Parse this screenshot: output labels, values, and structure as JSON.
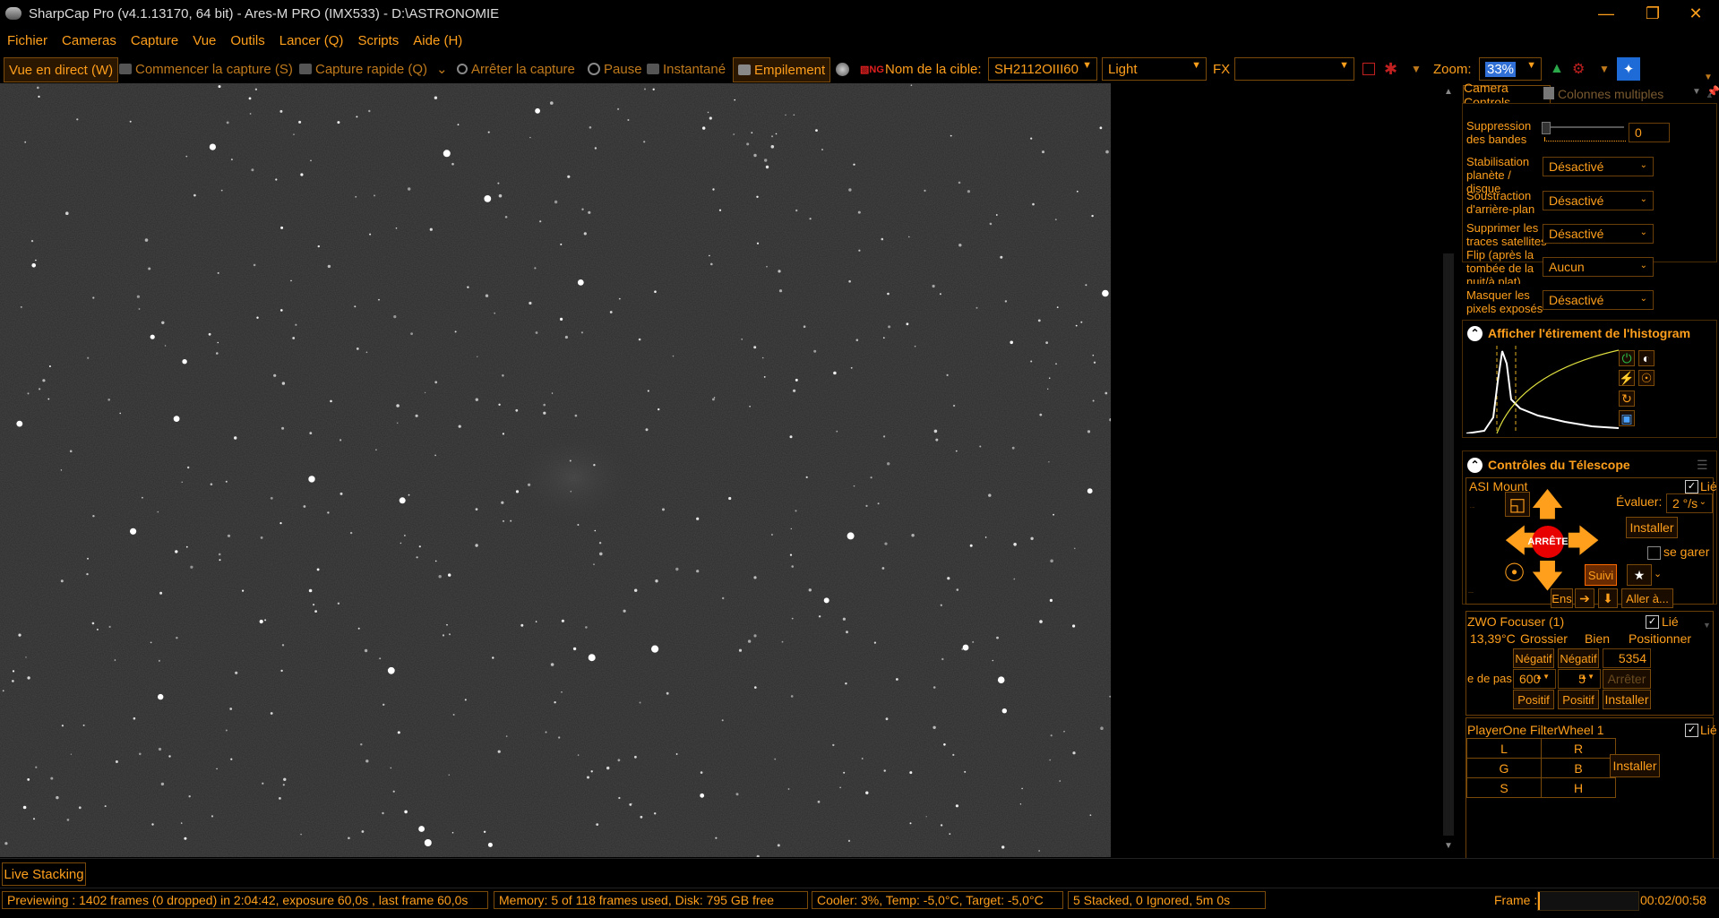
{
  "window": {
    "title": "SharpCap Pro (v4.1.13170, 64 bit) - Ares-M PRO (IMX533) - D:\\ASTRONOMIE"
  },
  "menu": [
    "Fichier",
    "Cameras",
    "Capture",
    "Vue",
    "Outils",
    "Lancer (Q)",
    "Scripts",
    "Aide (H)"
  ],
  "toolbar": {
    "live": "Vue en direct (W)",
    "start_capture": "Commencer la capture (S)",
    "quick_capture": "Capture rapide (Q)",
    "stop_capture": "Arrêter la capture",
    "pause": "Pause",
    "snapshot": "Instantané",
    "stacking": "Empilement",
    "target_label": "Nom de la cible:",
    "target_value": "SH2112OIII60",
    "frame_type": "Light",
    "fx_label": "FX",
    "fx_value": "",
    "zoom_label": "Zoom:",
    "zoom_value": "33%"
  },
  "camera_controls": {
    "tab1": "Camera Controls",
    "tab2": "Colonnes multiples",
    "rows": [
      {
        "label": "Suppression des bandes",
        "value": "0",
        "type": "slider"
      },
      {
        "label": "Stabilisation planète / disque",
        "value": "Désactivé"
      },
      {
        "label": "Soustraction d'arrière-plan",
        "value": "Désactivé"
      },
      {
        "label": "Supprimer les traces satellites",
        "value": "Désactivé"
      },
      {
        "label": "Flip (après la tombée de la nuit/à plat)",
        "value": "Aucun"
      },
      {
        "label": "Masquer les pixels exposés",
        "value": "Désactivé"
      }
    ]
  },
  "histogram": {
    "title": "Afficher l'étirement de l'histogram"
  },
  "telescope": {
    "title": "Contrôles du Télescope",
    "mount_name": "ASI Mount",
    "linked": "Lié",
    "rate_label": "Évaluer:",
    "rate_value": "2 °/s",
    "install": "Installer",
    "stop": "ARRÊTE",
    "park": "se garer",
    "tracking": "Suivi",
    "ens": "Ens",
    "goto": "Aller à..."
  },
  "focuser": {
    "name": "ZWO Focuser (1)",
    "linked": "Lié",
    "temp": "13,39°C",
    "coarse": "Grossier",
    "fine": "Bien",
    "position_label": "Positionner",
    "negative": "Négatif",
    "positive": "Positif",
    "position": "5354",
    "step_label": "e de pas",
    "coarse_step": "600",
    "fine_step": "5",
    "stop": "Arrêter",
    "install": "Installer"
  },
  "filterwheel": {
    "name": "PlayerOne FilterWheel 1",
    "linked": "Lié",
    "filters": [
      [
        "L",
        "R"
      ],
      [
        "G",
        "B"
      ],
      [
        "S",
        "H"
      ]
    ],
    "install": "Installer"
  },
  "bottom": {
    "live_stacking": "Live Stacking",
    "status1": "Previewing : 1402 frames (0 dropped) in 2:04:42, exposure 60,0s , last frame 60,0s",
    "status2": "Memory: 5 of 118 frames used, Disk: 795 GB free",
    "status3": "Cooler: 3%, Temp: -5,0°C, Target: -5,0°C",
    "status4": "5 Stacked, 0 Ignored, 5m 0s",
    "frame_label": "Frame :",
    "frame_progress": 0.02,
    "time": "00:02/00:58"
  }
}
